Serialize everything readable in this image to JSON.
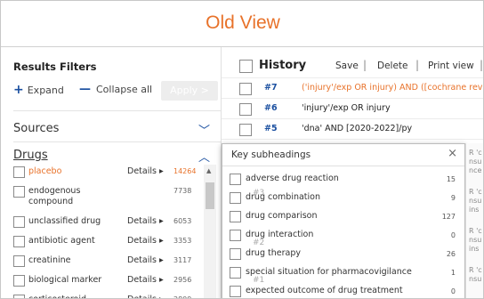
{
  "header": {
    "title": "Old View"
  },
  "filters": {
    "title": "Results Filters",
    "expand_label": "Expand",
    "collapse_label": "Collapse all",
    "apply_label": "Apply >",
    "sources_label": "Sources",
    "drugs_label": "Drugs",
    "details_label": "Details ▸",
    "drugs": [
      {
        "label": "placebo",
        "count": "14264",
        "details": true
      },
      {
        "label": "endogenous compound",
        "count": "7738",
        "details": false
      },
      {
        "label": "unclassified drug",
        "count": "6053",
        "details": true
      },
      {
        "label": "antibiotic agent",
        "count": "3353",
        "details": true
      },
      {
        "label": "creatinine",
        "count": "3117",
        "details": true
      },
      {
        "label": "biological marker",
        "count": "2956",
        "details": true
      },
      {
        "label": "corticosteroid",
        "count": "2809",
        "details": true
      }
    ]
  },
  "history": {
    "title": "History",
    "actions": {
      "save": "Save",
      "delete": "Delete",
      "print": "Print view"
    },
    "rows": [
      {
        "num": "#7",
        "query": "('injury'/exp OR injury) AND ([cochrane revie",
        "style": "red"
      },
      {
        "num": "#6",
        "query": "'injury'/exp OR injury",
        "style": "normal"
      },
      {
        "num": "#5",
        "query": "'dna' AND [2020-2022]/py",
        "style": "normal"
      },
      {
        "num": "#4",
        "query": "",
        "style": "normal"
      }
    ]
  },
  "popup": {
    "title": "Key subheadings",
    "close": "×",
    "items": [
      {
        "label": "adverse drug reaction",
        "count": "15"
      },
      {
        "label": "drug combination",
        "count": "9"
      },
      {
        "label": "drug comparison",
        "count": "127"
      },
      {
        "label": "drug interaction",
        "count": "0"
      },
      {
        "label": "drug therapy",
        "count": "26"
      },
      {
        "label": "special situation for pharmacovigilance",
        "count": "1"
      },
      {
        "label": "expected outcome of drug treatment",
        "count": "0"
      }
    ],
    "ghost_numbers": [
      "#3",
      "#2",
      "#1"
    ]
  }
}
